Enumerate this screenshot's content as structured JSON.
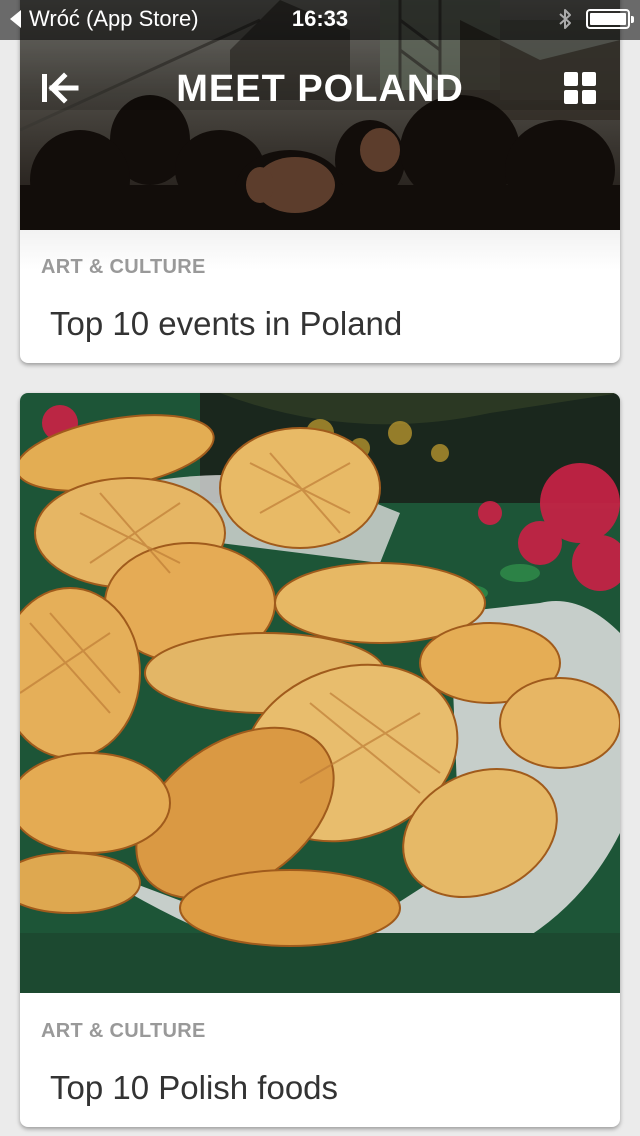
{
  "status_bar": {
    "back_label": "Wróć (App Store)",
    "time": "16:33",
    "bluetooth_icon": "bluetooth-icon",
    "battery_icon": "battery-icon"
  },
  "header": {
    "title": "MEET POLAND",
    "exit_icon": "exit-arrow-icon",
    "grid_icon": "grid-icon"
  },
  "cards": [
    {
      "category": "ART & CULTURE",
      "title": "Top 10 events in Poland"
    },
    {
      "category": "ART & CULTURE",
      "title": "Top 10 Polish foods"
    }
  ],
  "colors": {
    "category_text": "#999999",
    "title_text": "#333333",
    "card_background": "#ffffff",
    "page_background": "#ebebeb"
  }
}
